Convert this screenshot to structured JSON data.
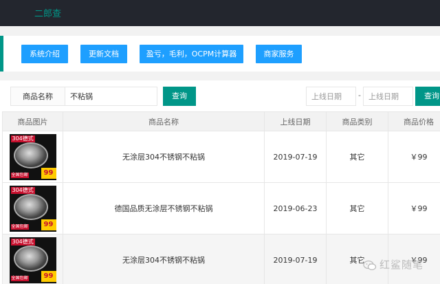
{
  "app": {
    "title": "二郎查"
  },
  "nav": {
    "buttons": [
      "系统介绍",
      "更新文档",
      "盈亏，毛利，OCPM计算器",
      "商家服务"
    ]
  },
  "search": {
    "label": "商品名称",
    "value": "不粘锅",
    "query_label": "查询",
    "date_start_placeholder": "上线日期",
    "date_separator": "-",
    "date_end_placeholder": "上线日期",
    "query2_label": "查询"
  },
  "table": {
    "headers": [
      "商品图片",
      "商品名称",
      "上线日期",
      "商品类别",
      "商品价格"
    ],
    "rows": [
      {
        "name": "无涂层304不锈钢不粘锅",
        "date": "2019-07-19",
        "category": "其它",
        "price": "￥99"
      },
      {
        "name": "德国品质无涂层不锈钢不粘锅",
        "date": "2019-06-23",
        "category": "其它",
        "price": "￥99"
      },
      {
        "name": "无涂层304不锈钢不粘锅",
        "date": "2019-07-19",
        "category": "其它",
        "price": "￥99"
      }
    ]
  },
  "thumbnail": {
    "tag": "304德式",
    "badge": "99",
    "ship": "全国包邮"
  },
  "watermark": {
    "text": "红鲨随笔",
    "icon": "wechat-icon"
  },
  "colors": {
    "primary_blue": "#1e9fff",
    "teal": "#009688",
    "topbar": "#23262e"
  }
}
